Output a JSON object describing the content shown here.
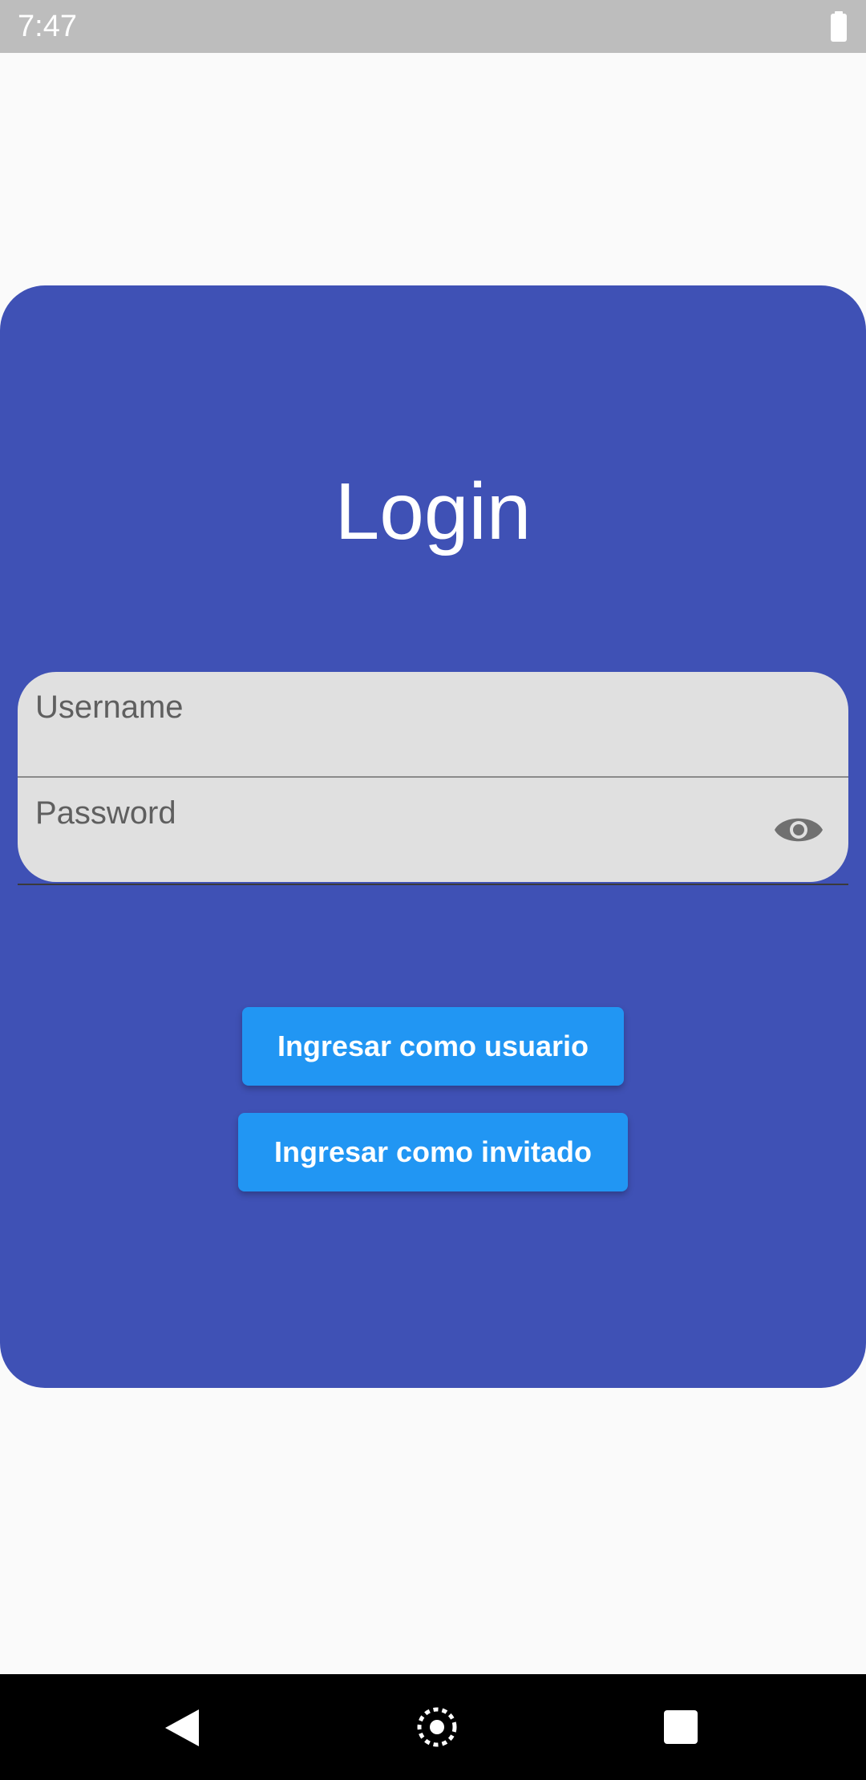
{
  "status_bar": {
    "time": "7:47",
    "battery_icon": "battery-full-icon"
  },
  "login": {
    "title": "Login",
    "username_label": "Username",
    "username_value": "",
    "password_label": "Password",
    "password_value": "",
    "password_toggle_icon": "eye-icon",
    "user_button_label": "Ingresar como usuario",
    "guest_button_label": "Ingresar como invitado"
  },
  "navigation_bar": {
    "back_icon": "back-triangle-icon",
    "home_icon": "home-icon",
    "recents_icon": "recents-square-icon"
  },
  "colors": {
    "card_background": "#3f51b5",
    "button_background": "#2196f3",
    "field_background": "#e0e0e0",
    "status_bar": "#bdbdbd",
    "page_background": "#fafafa"
  }
}
